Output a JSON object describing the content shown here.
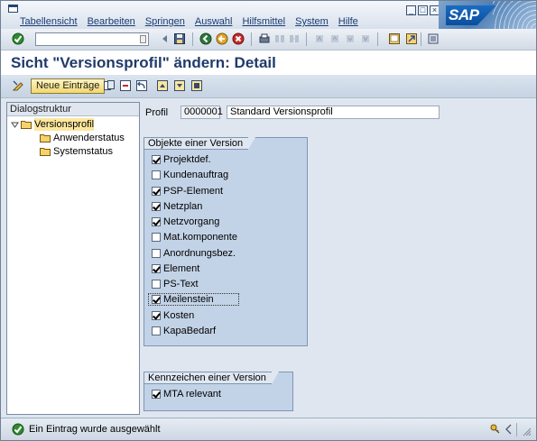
{
  "menu": [
    "Tabellensicht",
    "Bearbeiten",
    "Springen",
    "Auswahl",
    "Hilfsmittel",
    "System",
    "Hilfe"
  ],
  "brand": "SAP",
  "window_buttons": [
    "_",
    "□",
    "×"
  ],
  "okcode": {
    "value": ""
  },
  "title": "Sicht \"Versionsprofil\" ändern: Detail",
  "app_toolbar": {
    "neue_eintraege": "Neue Einträge"
  },
  "tree": {
    "header": "Dialogstruktur",
    "items": [
      {
        "label": "Versionsprofil",
        "level": 0,
        "expanded": true,
        "selected": true
      },
      {
        "label": "Anwenderstatus",
        "level": 1
      },
      {
        "label": "Systemstatus",
        "level": 1
      }
    ]
  },
  "profil": {
    "label": "Profil",
    "code": "0000001",
    "name": "Standard Versionsprofil"
  },
  "objects_group": {
    "title": "Objekte einer Version",
    "items": [
      {
        "label": "Projektdef.",
        "checked": true
      },
      {
        "label": "Kundenauftrag",
        "checked": false
      },
      {
        "label": "PSP-Element",
        "checked": true
      },
      {
        "label": "Netzplan",
        "checked": true
      },
      {
        "label": "Netzvorgang",
        "checked": true
      },
      {
        "label": "Mat.komponente",
        "checked": false
      },
      {
        "label": "Anordnungsbez.",
        "checked": false
      },
      {
        "label": "Element",
        "checked": true
      },
      {
        "label": "PS-Text",
        "checked": false
      },
      {
        "label": "Meilenstein",
        "checked": true,
        "focused": true
      },
      {
        "label": "Kosten",
        "checked": true
      },
      {
        "label": "KapaBedarf",
        "checked": false
      }
    ]
  },
  "kenn_group": {
    "title": "Kennzeichen einer Version",
    "items": [
      {
        "label": "MTA relevant",
        "checked": true
      }
    ]
  },
  "status": {
    "message": "Ein Eintrag wurde ausgewählt",
    "type": "success"
  },
  "colors": {
    "title": "#203a6b",
    "menu": "#1b3b73",
    "group_bg": "#c3d3e7",
    "selected": "#fbe79e"
  }
}
